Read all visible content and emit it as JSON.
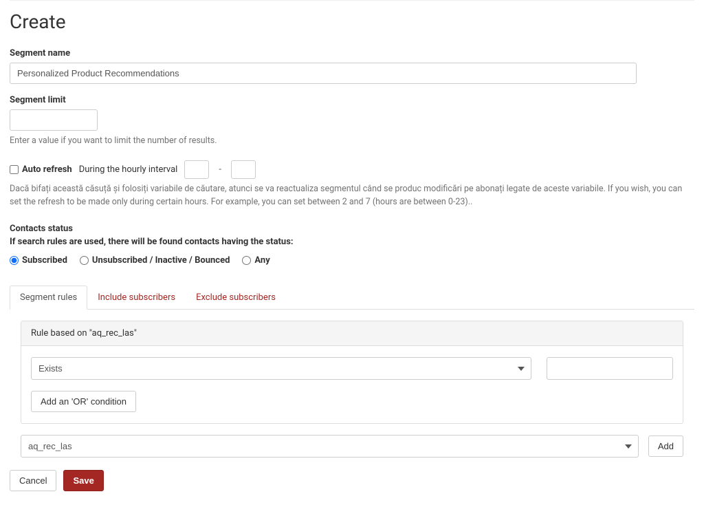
{
  "page": {
    "title": "Create"
  },
  "segment_name": {
    "label": "Segment name",
    "value": "Personalized Product Recommendations"
  },
  "segment_limit": {
    "label": "Segment limit",
    "value": "",
    "help": "Enter a value if you want to limit the number of results."
  },
  "auto_refresh": {
    "label": "Auto refresh",
    "interval_label": "During the hourly interval",
    "from": "",
    "to": "",
    "help": "Dacă bifați această căsuță și folosiți variabile de căutare, atunci se va reactualiza segmentul când se produc modificări pe abonați legate de aceste variabile. If you wish, you can set the refresh to be made only during certain hours. For example, you can set between 2 and 7 (hours are between 0-23).."
  },
  "contacts_status": {
    "heading": "Contacts status",
    "subtext": "If search rules are used, there will be found contacts having the status:",
    "options": {
      "subscribed": "Subscribed",
      "unsubscribed": "Unsubscribed / Inactive / Bounced",
      "any": "Any"
    },
    "selected": "subscribed"
  },
  "tabs": {
    "rules": "Segment rules",
    "include": "Include subscribers",
    "exclude": "Exclude subscribers"
  },
  "rule_panel": {
    "header": "Rule based on \"aq_rec_las\"",
    "operator": "Exists",
    "value": "",
    "add_or_label": "Add an 'OR' condition"
  },
  "field_selector": {
    "selected": "aq_rec_las",
    "add_label": "Add"
  },
  "footer": {
    "cancel": "Cancel",
    "save": "Save"
  }
}
